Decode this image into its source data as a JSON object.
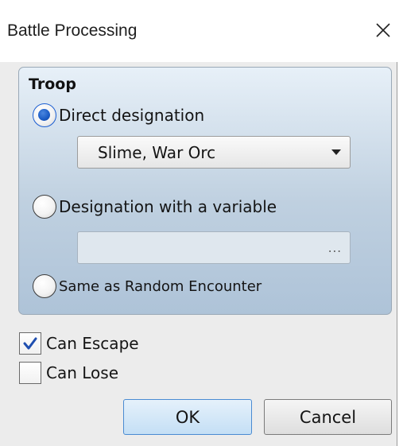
{
  "window": {
    "title": "Battle Processing",
    "close_icon": "close-icon"
  },
  "troop": {
    "group_label": "Troop",
    "options": [
      {
        "label": "Direct designation",
        "selected": true
      },
      {
        "label": "Designation with a variable",
        "selected": false
      },
      {
        "label": "Same as Random Encounter",
        "selected": false
      }
    ],
    "dropdown": {
      "value": "Slime, War Orc",
      "icon": "chevron-down-icon"
    },
    "variable_field": {
      "value": "",
      "button_label": "..."
    }
  },
  "checkboxes": [
    {
      "label": "Can Escape",
      "checked": true
    },
    {
      "label": "Can Lose",
      "checked": false
    }
  ],
  "buttons": {
    "ok": "OK",
    "cancel": "Cancel"
  },
  "colors": {
    "accent": "#1a5bc4",
    "group_bg_top": "#e7f0f8",
    "group_bg_bottom": "#aec3d8",
    "ok_border": "#4a8bd2"
  }
}
